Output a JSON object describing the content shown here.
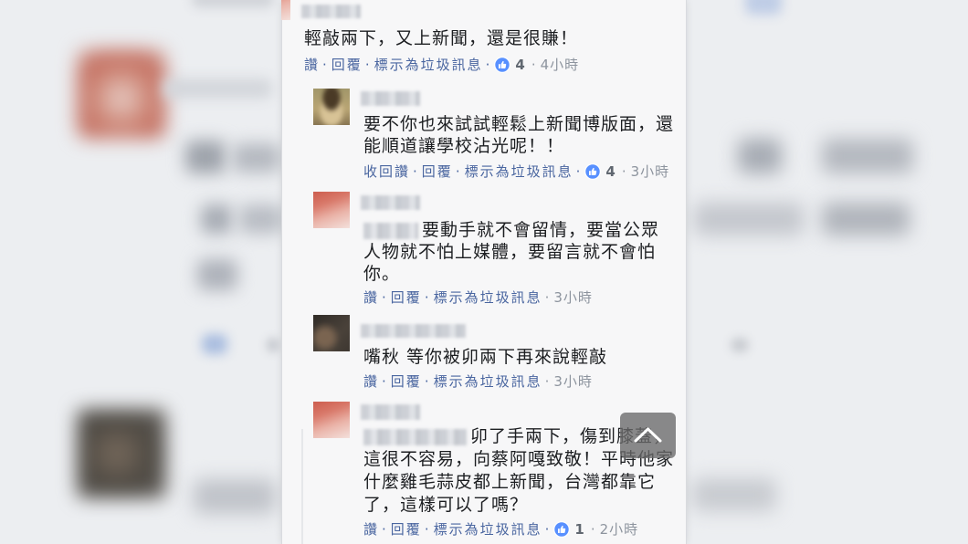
{
  "colors": {
    "text": "#1c1e21",
    "link": "#4a66a0",
    "meta": "#8d949e",
    "count": "#606770",
    "reaction": "#5890ff",
    "strip_bg": "#f7f7f8",
    "page_bg": "#eceef1"
  },
  "icons": {
    "reaction": "like-reaction-icon",
    "scroll_top": "chevron-up-icon"
  },
  "separator": "·",
  "thread": {
    "comment": {
      "text_lines": [
        "輕敲兩下，又上新聞，還是很賺！"
      ],
      "actions": {
        "like": "讚",
        "reply": "回覆",
        "spam": "標示為垃圾訊息",
        "reaction_count": "4",
        "time": "4小時"
      }
    },
    "replies": [
      {
        "text_lines": [
          "要不你也來試試輕鬆上新聞博版面，還",
          "能順道讓學校沾光呢！！"
        ],
        "actions": {
          "like": "收回讚",
          "reply": "回覆",
          "spam": "標示為垃圾訊息",
          "reaction_count": "4",
          "time": "3小時"
        }
      },
      {
        "text_lines": [
          "要動手就不會留情，要當公眾",
          "人物就不怕上媒體，要留言就不會怕",
          "你。"
        ],
        "actions": {
          "like": "讚",
          "reply": "回覆",
          "spam": "標示為垃圾訊息",
          "time": "3小時"
        }
      },
      {
        "text_lines": [
          "嘴秋 等你被卯兩下再來說輕敲"
        ],
        "actions": {
          "like": "讚",
          "reply": "回覆",
          "spam": "標示為垃圾訊息",
          "time": "3小時"
        }
      },
      {
        "text_lines": [
          "卯了手兩下，傷到膝蓋，",
          "這很不容易，向蔡阿嘎致敬！平時他家",
          "什麼雞毛蒜皮都上新聞，台灣都靠它",
          "了，這樣可以了嗎？"
        ],
        "actions": {
          "like": "讚",
          "reply": "回覆",
          "spam": "標示為垃圾訊息",
          "reaction_count": "1",
          "time": "2小時"
        }
      }
    ]
  }
}
